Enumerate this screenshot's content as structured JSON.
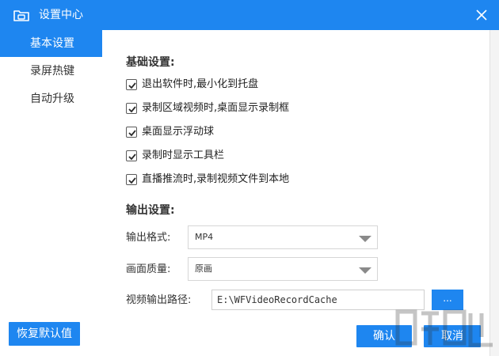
{
  "window": {
    "title": "设置中心",
    "close_icon": "close-icon",
    "app_icon": "folder-camera-icon"
  },
  "sidebar": {
    "items": [
      {
        "label": "基本设置",
        "active": true
      },
      {
        "label": "录屏热键",
        "active": false
      },
      {
        "label": "自动升级",
        "active": false
      }
    ]
  },
  "basic": {
    "title": "基础设置:",
    "options": [
      {
        "label": "退出软件时,最小化到托盘",
        "checked": true
      },
      {
        "label": "录制区域视频时,桌面显示录制框",
        "checked": true
      },
      {
        "label": "桌面显示浮动球",
        "checked": true
      },
      {
        "label": "录制时显示工具栏",
        "checked": true
      },
      {
        "label": "直播推流时,录制视频文件到本地",
        "checked": true
      }
    ]
  },
  "output": {
    "title": "输出设置:",
    "format_label": "输出格式:",
    "format_value": "MP4",
    "quality_label": "画面质量:",
    "quality_value": "原画",
    "path_label": "视频输出路径:",
    "path_value": "E:\\WFVideoRecordCache",
    "browse_label": "..."
  },
  "footer": {
    "reset_label": "恢复默认值",
    "ok_label": "确认",
    "cancel_label": "取消"
  },
  "colors": {
    "accent": "#1e86f0",
    "text": "#333333"
  }
}
